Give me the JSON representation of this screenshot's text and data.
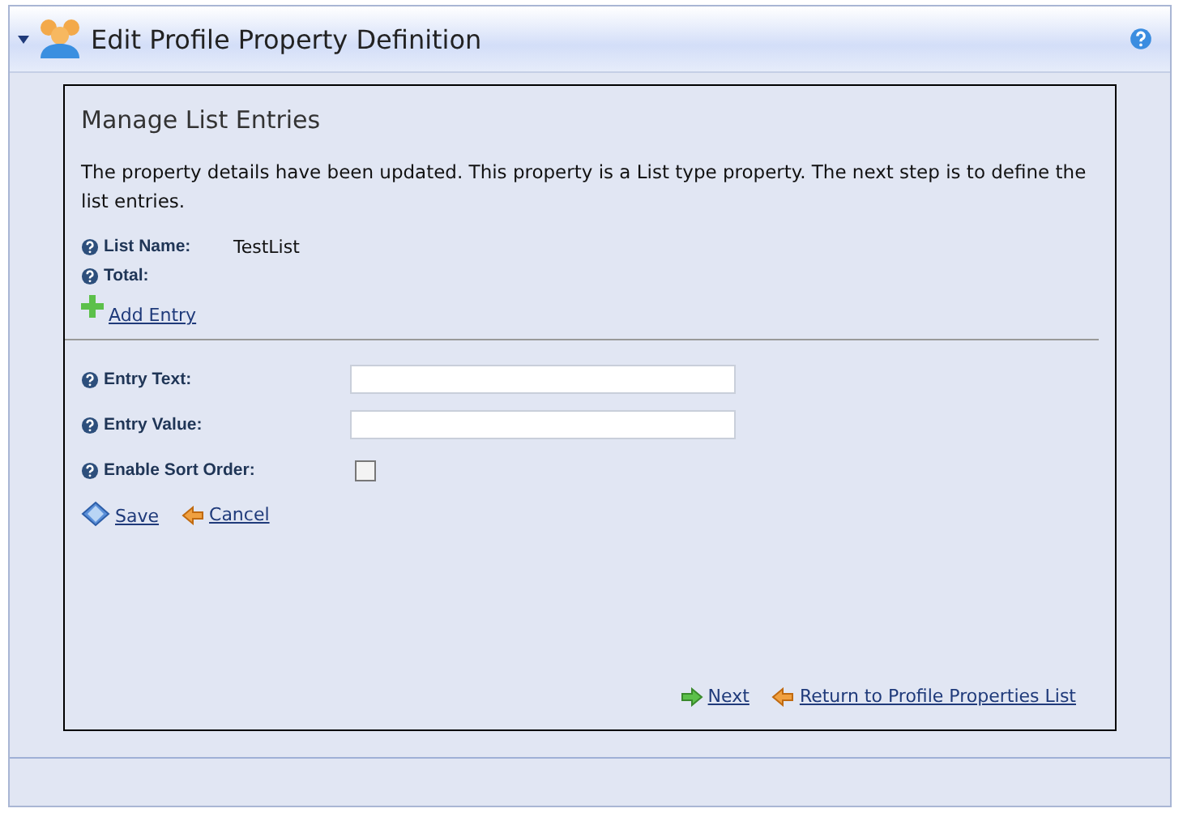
{
  "header": {
    "title": "Edit Profile Property Definition"
  },
  "section": {
    "title": "Manage List Entries",
    "message": "The property details have been updated. This property is a List type property. The next step is to define the list entries.",
    "info": [
      {
        "label": "List Name:",
        "value": "TestList"
      },
      {
        "label": "Total:"
      }
    ],
    "add_link": "Add Entry",
    "fields": [
      {
        "kind": "text",
        "label": "Entry Text:"
      },
      {
        "kind": "text",
        "label": "Entry Value:"
      },
      {
        "kind": "checkbox",
        "label": "Enable Sort Order:",
        "checked": false
      }
    ],
    "actions": [
      {
        "kind": "save",
        "label": "Save"
      },
      {
        "kind": "back",
        "label": "Cancel"
      }
    ],
    "footer_links": [
      {
        "kind": "next",
        "label": "Next"
      },
      {
        "kind": "back",
        "label": "Return to Profile Properties List"
      }
    ]
  }
}
